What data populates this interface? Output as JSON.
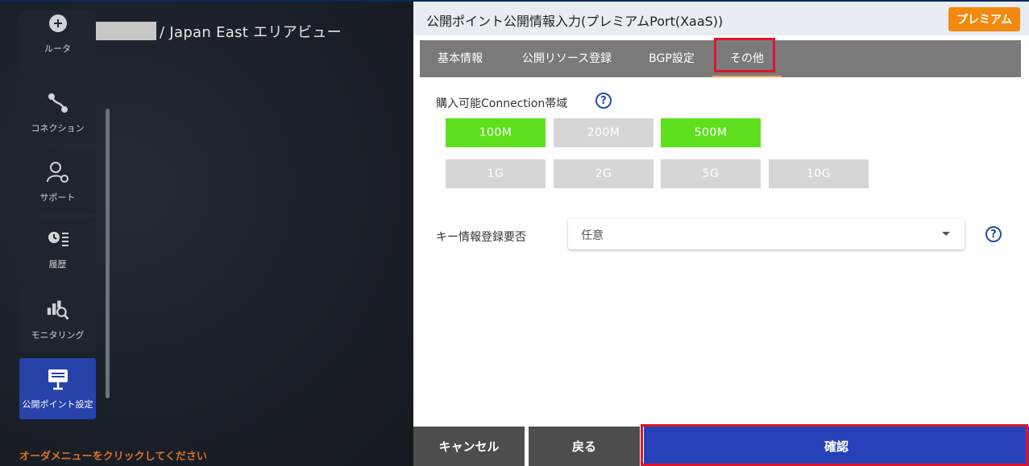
{
  "background": {
    "title": "/ Japan East エリアビュー",
    "order_message": "オーダメニューをクリックしてください"
  },
  "sidebar": {
    "items": [
      {
        "label": "ルータ",
        "icon": "router-icon"
      },
      {
        "label": "コネクション",
        "icon": "connection-icon"
      },
      {
        "label": "サポート",
        "icon": "support-icon"
      },
      {
        "label": "履歴",
        "icon": "history-icon"
      },
      {
        "label": "モニタリング",
        "icon": "monitoring-icon"
      },
      {
        "label": "公開ポイント設定",
        "icon": "public-point-icon",
        "active": true
      }
    ]
  },
  "dialog": {
    "title": "公開ポイント公開情報入力(プレミアムPort(XaaS))",
    "badge": "プレミアム",
    "tabs": [
      {
        "label": "基本情報"
      },
      {
        "label": "公開リソース登録"
      },
      {
        "label": "BGP設定"
      },
      {
        "label": "その他",
        "active": true
      }
    ],
    "bandwidth": {
      "label": "購入可能Connection帯域",
      "help": "?",
      "options": [
        {
          "label": "100M",
          "selected": true
        },
        {
          "label": "200M",
          "selected": false
        },
        {
          "label": "500M",
          "selected": true
        },
        {
          "label": "1G",
          "selected": false
        },
        {
          "label": "2G",
          "selected": false
        },
        {
          "label": "5G",
          "selected": false
        },
        {
          "label": "10G",
          "selected": false
        }
      ]
    },
    "key_registration": {
      "label": "キー情報登録要否",
      "value": "任意",
      "help": "?"
    },
    "footer": {
      "cancel": "キャンセル",
      "back": "戻る",
      "confirm": "確認"
    }
  },
  "colors": {
    "accent_blue": "#2742b8",
    "selected_green": "#5ee01e",
    "premium_orange": "#f28a10",
    "highlight_red": "#e0142c"
  }
}
